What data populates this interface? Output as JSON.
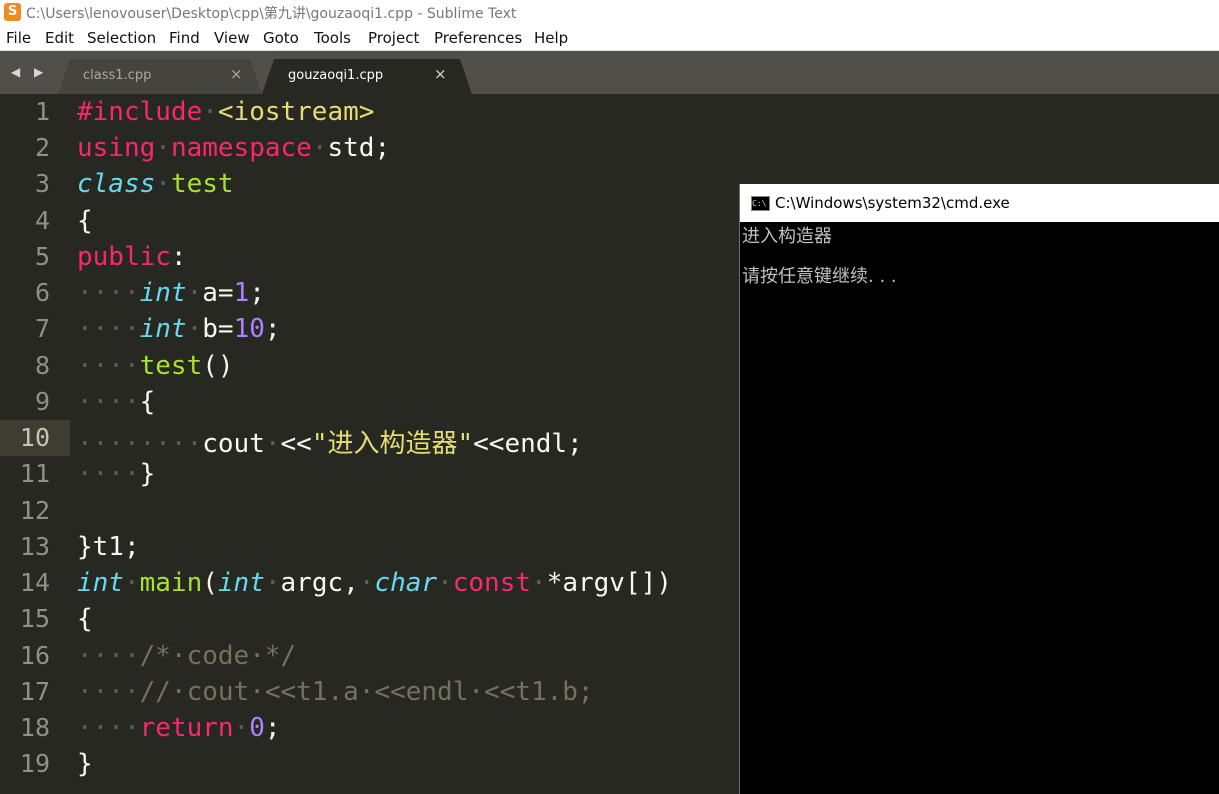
{
  "window": {
    "title": "C:\\Users\\lenovouser\\Desktop\\cpp\\第九讲\\gouzaoqi1.cpp - Sublime Text",
    "icon_glyph": "S"
  },
  "menu": [
    "File",
    "Edit",
    "Selection",
    "Find",
    "View",
    "Goto",
    "Tools",
    "Project",
    "Preferences",
    "Help"
  ],
  "tabs": [
    {
      "label": "class1.cpp",
      "active": false
    },
    {
      "label": "gouzaoqi1.cpp",
      "active": true
    }
  ],
  "tab_nav_arrows": "◀ ▶",
  "tab_close_glyph": "×",
  "editor": {
    "current_line": 10,
    "lines": [
      "1",
      "2",
      "3",
      "4",
      "5",
      "6",
      "7",
      "8",
      "9",
      "10",
      "11",
      "12",
      "13",
      "14",
      "15",
      "16",
      "17",
      "18",
      "19"
    ]
  },
  "console": {
    "title": "C:\\Windows\\system32\\cmd.exe",
    "icon_text": "C:\\",
    "output": [
      "进入构造器",
      "请按任意键继续. . ."
    ]
  },
  "colors": {
    "editor_bg": "#272822",
    "keyword": "#f92672",
    "type": "#66d9ef",
    "function": "#a6e22e",
    "number": "#ae81ff",
    "string": "#e6db74",
    "comment": "#75715e",
    "console_bg": "#000000"
  },
  "code_text": {
    "l1": [
      "#include",
      "<iostream>"
    ],
    "l2": [
      "using",
      "namespace",
      "std;"
    ],
    "l3": [
      "class",
      "test"
    ],
    "l4": "{",
    "l5": [
      "public",
      ":"
    ],
    "l6": [
      "int",
      "a=",
      "1",
      ";"
    ],
    "l7": [
      "int",
      "b=",
      "10",
      ";"
    ],
    "l8": [
      "test",
      "()"
    ],
    "l9": "{",
    "l10": [
      "cout",
      "<<",
      "\"进入构造器\"",
      "<<endl;"
    ],
    "l11": "}",
    "l12": "",
    "l13": "}t1;",
    "l14": [
      "int",
      "main",
      "(",
      "int",
      "argc,",
      "char",
      "const",
      "*argv[])"
    ],
    "l15": "{",
    "l16": "/*·code·*/",
    "l17": "//·cout·<<t1.a·<<endl·<<t1.b;",
    "l18": [
      "return",
      "0",
      ";"
    ],
    "l19": "}"
  },
  "whitespace": {
    "dot": "·",
    "indent4": "····",
    "indent8": "········"
  }
}
